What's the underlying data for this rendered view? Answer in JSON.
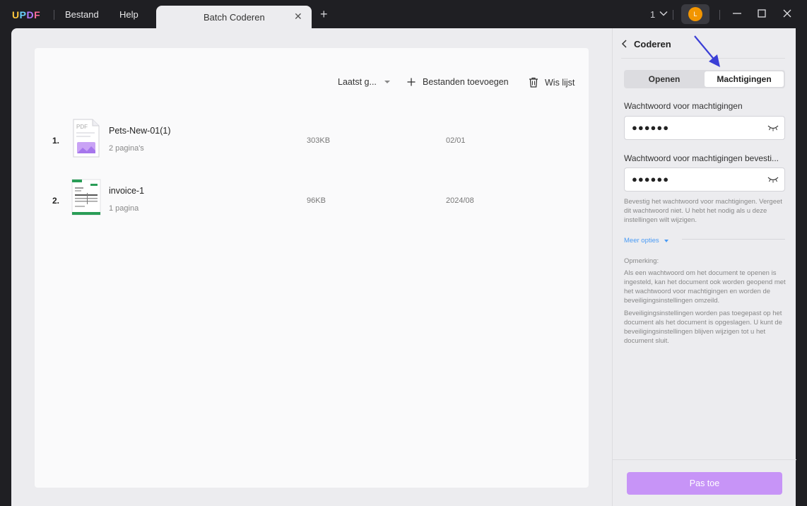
{
  "titlebar": {
    "logo": "UPDF",
    "menu": [
      "Bestand",
      "Help"
    ],
    "tab_title": "Batch Coderen",
    "page_count": "1",
    "avatar_initial": "L"
  },
  "toolbar": {
    "sort_label": "Laatst g...",
    "add_files_label": "Bestanden toevoegen",
    "clear_list_label": "Wis lijst"
  },
  "files": [
    {
      "index": "1.",
      "name": "Pets-New-01(1)",
      "pages": "2 pagina's",
      "size": "303KB",
      "date": "02/01",
      "thumb_label": "PDF"
    },
    {
      "index": "2.",
      "name": "invoice-1",
      "pages": "1 pagina",
      "size": "96KB",
      "date": "2024/08"
    }
  ],
  "panel": {
    "title": "Coderen",
    "tabs": [
      "Openen",
      "Machtigingen"
    ],
    "active_tab": "Machtigingen",
    "password_label": "Wachtwoord voor machtigingen",
    "password_value": "●●●●●●",
    "confirm_label": "Wachtwoord voor machtigingen bevesti...",
    "confirm_value": "●●●●●●",
    "hint": "Bevestig het wachtwoord voor machtigingen. Vergeet dit wachtwoord niet. U hebt het nodig als u deze instellingen wilt wijzigen.",
    "more_options": "Meer opties",
    "remark_title": "Opmerking:",
    "remark_1": "Als een wachtwoord om het document te openen is ingesteld, kan het document ook worden geopend met het wachtwoord voor machtigingen en worden de beveiligingsinstellingen omzeild.",
    "remark_2": "Beveiligingsinstellingen worden pas toegepast op het document als het document is opgeslagen. U kunt de beveiligingsinstellingen blijven wijzigen tot u het document sluit.",
    "apply_label": "Pas toe"
  },
  "colors": {
    "accent": "#c794f7",
    "link": "#4a9bf5",
    "annotation_arrow": "#3b3fd6"
  }
}
